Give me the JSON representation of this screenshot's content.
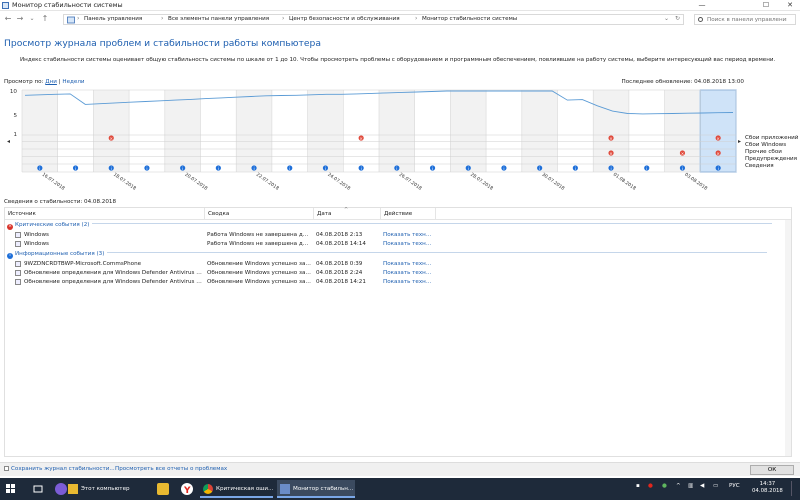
{
  "window": {
    "title": "Монитор стабильности системы",
    "controls": {
      "minimize": "—",
      "maximize": "☐",
      "close": "✕"
    }
  },
  "nav": {
    "breadcrumbs": [
      "Панель управления",
      "Все элементы панели управления",
      "Центр безопасности и обслуживания",
      "Монитор стабильности системы"
    ],
    "search_placeholder": "Поиск в панели управления"
  },
  "page": {
    "heading": "Просмотр журнала проблем и стабильности работы компьютера",
    "description": "Индекс стабильности системы оценивает общую стабильность системы по шкале от 1 до 10. Чтобы просмотреть проблемы с оборудованием и программным обеспечением, повлиявшие на работу системы, выберите интересующий вас период времени.",
    "view_by_label": "Просмотр по:",
    "view_days": "Дни",
    "view_sep": "|",
    "view_weeks": "Недели",
    "last_update": "Последнее обновление: 04.08.2018 13:00"
  },
  "chart_data": {
    "type": "line",
    "y_ticks": [
      "10",
      "5",
      "1"
    ],
    "ylim": [
      1,
      10
    ],
    "x_labels": [
      "16.07.2018",
      "18.07.2018",
      "20.07.2018",
      "22.07.2018",
      "24.07.2018",
      "26.07.2018",
      "28.07.2018",
      "30.07.2018",
      "01.08.2018",
      "03.08.2018"
    ],
    "stability_index": [
      9.1,
      9.2,
      9.3,
      9.4,
      7.2,
      7.35,
      7.5,
      7.65,
      7.8,
      7.95,
      8.1,
      8.25,
      8.4,
      8.55,
      8.7,
      8.85,
      9.0,
      9.05,
      9.1,
      9.2,
      9.3,
      9.3,
      9.4,
      9.5,
      9.6,
      9.7,
      9.8,
      9.9,
      10,
      10,
      10,
      10,
      10,
      10,
      10,
      10,
      8.1,
      8.2,
      6.9,
      5.8,
      5.3,
      5.2,
      5.25,
      5.3,
      5.35,
      5.4,
      5.45,
      5.5
    ],
    "rows": [
      "Сбои приложений",
      "Сбои Windows",
      "Прочие сбои",
      "Предупреждения",
      "Сведения"
    ],
    "events": {
      "app_failures": [
        5,
        19,
        33,
        38
      ],
      "other_failures": [
        33,
        36,
        39
      ],
      "info": [
        0,
        2,
        4,
        6,
        8,
        10,
        12,
        14,
        16,
        18,
        20,
        22,
        24,
        26,
        28,
        30,
        32,
        34,
        36,
        38
      ]
    },
    "selected_column_index": 19
  },
  "details": {
    "label": "Сведения о стабильности: 04.08.2018",
    "columns": [
      "Источник",
      "Сводка",
      "Дата",
      "Действие"
    ],
    "groups": [
      {
        "title": "Критические события (2)",
        "color": "#d9342b",
        "icon": "×",
        "rows": [
          {
            "source": "Windows",
            "summary": "Работа Windows не завершена долж...",
            "date": "04.08.2018 2:13",
            "action": "Показать технич..."
          },
          {
            "source": "Windows",
            "summary": "Работа Windows не завершена долж...",
            "date": "04.08.2018 14:14",
            "action": "Показать технич..."
          }
        ]
      },
      {
        "title": "Информационные события (3)",
        "color": "#1e6fd9",
        "icon": "i",
        "rows": [
          {
            "source": "9WZDNCRDTBWP-Microsoft.CommsPhone",
            "summary": "Обновление Windows успешно завер...",
            "date": "04.08.2018 0:39",
            "action": "Показать технич..."
          },
          {
            "source": "Обновление определения для Windows Defender Antivirus – KB2267...",
            "summary": "Обновление Windows успешно завер...",
            "date": "04.08.2018 2:24",
            "action": "Показать технич..."
          },
          {
            "source": "Обновление определения для Windows Defender Antivirus – KB2267...",
            "summary": "Обновление Windows успешно завер...",
            "date": "04.08.2018 14:21",
            "action": "Показать технич..."
          }
        ]
      }
    ]
  },
  "footer": {
    "save_link": "Сохранить журнал стабильности...",
    "view_all_link": "Просмотреть все отчеты о проблемах",
    "ok_label": "ОК"
  },
  "taskbar": {
    "apps": [
      {
        "label": "Этот компьютер",
        "icon": "folder-icon"
      },
      {
        "label": "Критическая оши...",
        "icon": "chrome-icon"
      },
      {
        "label": "Монитор стабильн...",
        "icon": "monitor-icon"
      }
    ],
    "tray_lang": "РУС",
    "time": "14:37",
    "date": "04.08.2018"
  }
}
